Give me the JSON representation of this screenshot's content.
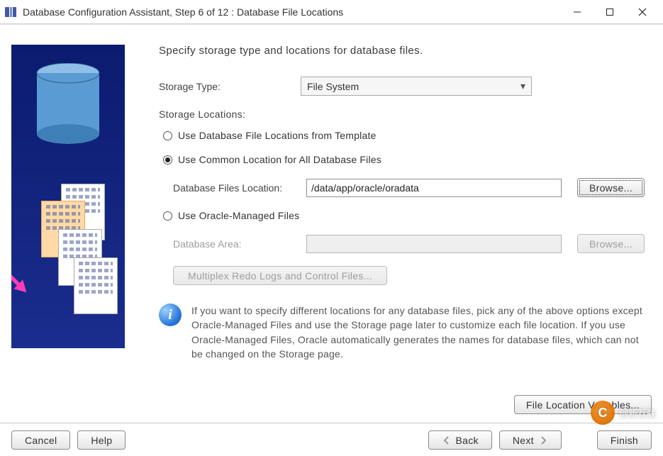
{
  "window": {
    "title": "Database Configuration Assistant, Step 6 of 12 : Database File Locations"
  },
  "heading": "Specify storage type and locations for database files.",
  "storage_type": {
    "label": "Storage Type:",
    "value": "File System"
  },
  "storage_locations_label": "Storage Locations:",
  "radios": {
    "from_template": {
      "label": "Use Database File Locations from Template",
      "checked": false
    },
    "common_location": {
      "label": "Use Common Location for All Database Files",
      "checked": true
    },
    "oracle_managed": {
      "label": "Use Oracle-Managed Files",
      "checked": false
    }
  },
  "db_files_location": {
    "label": "Database Files Location:",
    "value": "/data/app/oracle/oradata",
    "browse": "Browse..."
  },
  "db_area": {
    "label": "Database Area:",
    "value": "",
    "browse": "Browse..."
  },
  "multiplex_btn": "Multiplex Redo Logs and Control Files...",
  "info_text": "If you want to specify different locations for any database files, pick any of the above options except Oracle-Managed Files and use the Storage page later to customize each file location. If you use Oracle-Managed Files, Oracle automatically generates the names for database files, which can not be changed on the Storage page.",
  "file_location_variables_btn": "File Location Variables...",
  "footer": {
    "cancel": "Cancel",
    "help": "Help",
    "back": "Back",
    "next": "Next",
    "finish": "Finish"
  },
  "watermark": "创新互联"
}
